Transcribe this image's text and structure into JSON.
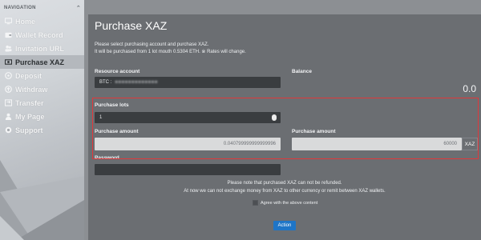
{
  "sidebar": {
    "header": "NAVIGATION",
    "items": [
      {
        "label": "Home",
        "icon": "monitor-icon"
      },
      {
        "label": "Wallet Record",
        "icon": "wallet-icon"
      },
      {
        "label": "Invitation URL",
        "icon": "users-icon"
      },
      {
        "label": "Purchase XAZ",
        "icon": "cash-icon",
        "active": true
      },
      {
        "label": "Deposit",
        "icon": "deposit-icon"
      },
      {
        "label": "Withdraw",
        "icon": "withdraw-icon"
      },
      {
        "label": "Transfer",
        "icon": "transfer-icon"
      },
      {
        "label": "My Page",
        "icon": "user-icon"
      },
      {
        "label": "Support",
        "icon": "support-icon"
      }
    ]
  },
  "main": {
    "title": "Purchase XAZ",
    "desc_line1": "Please select purchasing account and purchase XAZ.",
    "desc_line2": "It will be purchased from 1 lot mouth 0.5304 ETH. ※ Rates will change.",
    "resource_account_label": "Resource account",
    "resource_account_prefix": "BTC :",
    "balance_label": "Balance",
    "balance_value": "0.0",
    "purchase_lots_label": "Purchase lots",
    "purchase_lots_value": "1",
    "purchase_amount_label_1": "Purchase amount",
    "purchase_amount_value_1": "0.040799999999999996",
    "purchase_amount_label_2": "Purchase amount",
    "purchase_amount_value_2": "60000",
    "purchase_amount_unit": "XAZ",
    "password_label": "Password",
    "notice_line1": "Please note that purchased XAZ can not be refunded.",
    "notice_line2": "At now we can not exchange money from XAZ to other currency or remit between XAZ wallets.",
    "agree_label": "Agree with the above content",
    "action_label": "Action"
  },
  "colors": {
    "accent": "#1e75c7",
    "highlight": "#e0383b",
    "panel": "#6b6e72"
  }
}
